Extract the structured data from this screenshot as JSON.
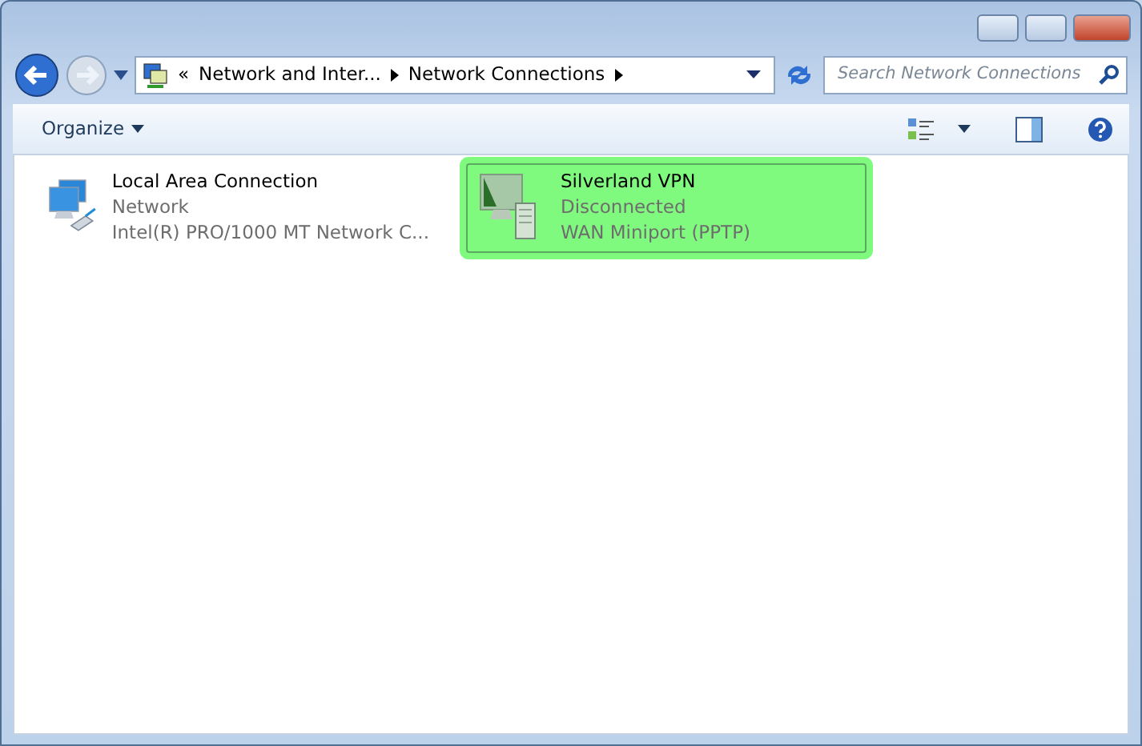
{
  "address_bar": {
    "crumbs": [
      "«",
      "Network and Inter...",
      "Network Connections"
    ]
  },
  "search": {
    "placeholder": "Search Network Connections"
  },
  "toolbar": {
    "organize": "Organize"
  },
  "connections": [
    {
      "name": "Local Area Connection",
      "status": "Network",
      "device": "Intel(R) PRO/1000 MT Network C...",
      "kind": "lan",
      "selected": false
    },
    {
      "name": "Silverland VPN",
      "status": "Disconnected",
      "device": "WAN Miniport (PPTP)",
      "kind": "vpn",
      "selected": true
    }
  ]
}
